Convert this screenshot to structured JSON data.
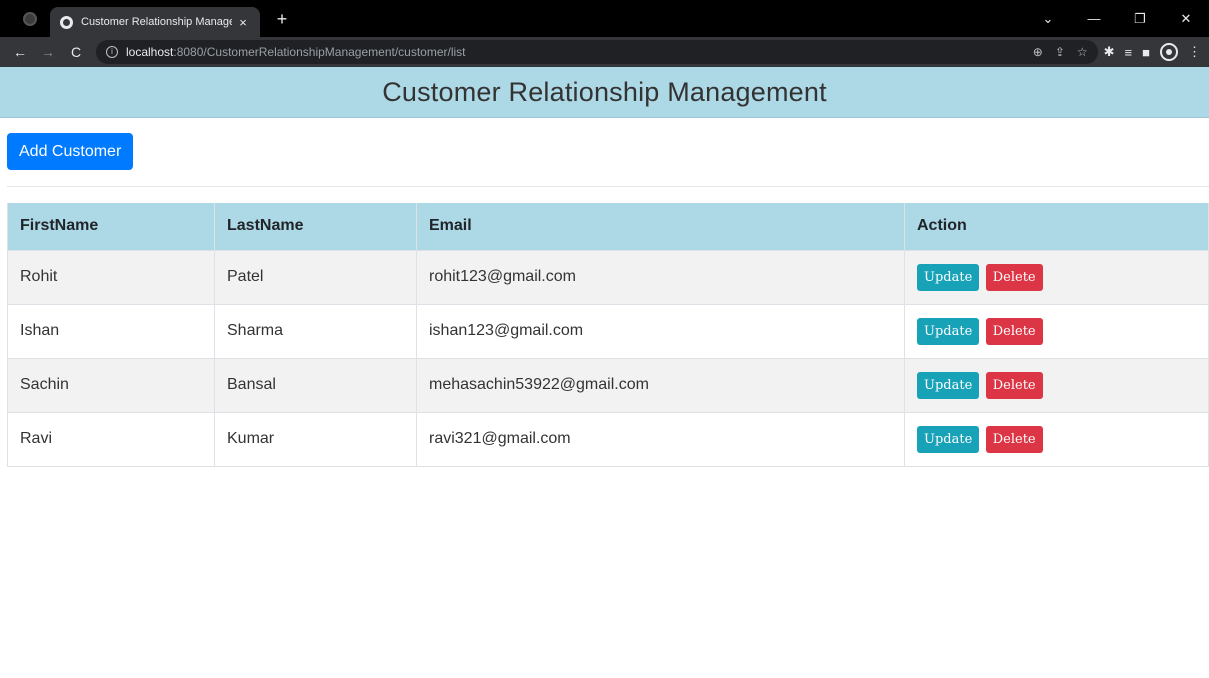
{
  "browser": {
    "tab_title": "Customer Relationship Managem",
    "tab_close": "×",
    "new_tab": "+",
    "url_host": "localhost",
    "url_path": ":8080/CustomerRelationshipManagement/customer/list",
    "window_controls": [
      "⌄",
      "—",
      "❐",
      "✕"
    ]
  },
  "header": {
    "title": "Customer Relationship Management"
  },
  "actions": {
    "add_label": "Add Customer"
  },
  "table": {
    "columns": [
      "FirstName",
      "LastName",
      "Email",
      "Action"
    ],
    "rows": [
      {
        "first": "Rohit",
        "last": "Patel",
        "email": "rohit123@gmail.com"
      },
      {
        "first": "Ishan",
        "last": "Sharma",
        "email": "ishan123@gmail.com"
      },
      {
        "first": "Sachin",
        "last": "Bansal",
        "email": "mehasachin53922@gmail.com"
      },
      {
        "first": "Ravi",
        "last": "Kumar",
        "email": "ravi321@gmail.com"
      }
    ],
    "update_label": "Update",
    "delete_label": "Delete"
  },
  "colors": {
    "header_bg": "#add8e6",
    "primary": "#007bff",
    "info": "#17a2b8",
    "danger": "#dc3545"
  }
}
